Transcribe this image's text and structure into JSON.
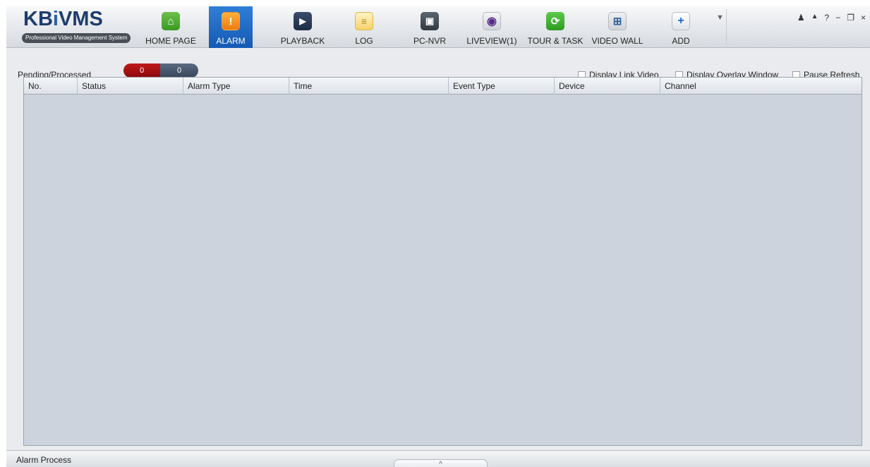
{
  "app": {
    "logo_text_a": "KB",
    "logo_text_b": "i",
    "logo_text_c": "VMS",
    "logo_subtitle": "Professional Video Management System"
  },
  "nav": {
    "home": "HOME PAGE",
    "alarm": "ALARM",
    "playback": "PLAYBACK",
    "log": "LOG",
    "pcnvr": "PC-NVR",
    "liveview": "LIVEVIEW(1)",
    "tour": "TOUR & TASK",
    "wall": "VIDEO WALL",
    "add": "ADD",
    "active": "ALARM"
  },
  "window_controls": {
    "user": "♟",
    "lock": "🔒",
    "help": "?",
    "minimize": "−",
    "restore": "❐",
    "close": "×"
  },
  "filter": {
    "pending_processed_label": "Pending/Processed",
    "pending_count": "0",
    "processed_count": "0",
    "display_link_video": "Display Link Video",
    "display_overlay_window": "Display Overlay Window",
    "pause_refresh": "Pause Refresh"
  },
  "table": {
    "columns": [
      "No.",
      "Status",
      "Alarm Type",
      "Time",
      "Event Type",
      "Device",
      "Channel"
    ],
    "rows": []
  },
  "statusbar": {
    "title": "Alarm Process",
    "expand_glyph": "^"
  },
  "colors": {
    "accent_active": "#1a66c0",
    "pending": "#b01214",
    "processed": "#4a5870",
    "table_bg": "#ccd3dd"
  }
}
